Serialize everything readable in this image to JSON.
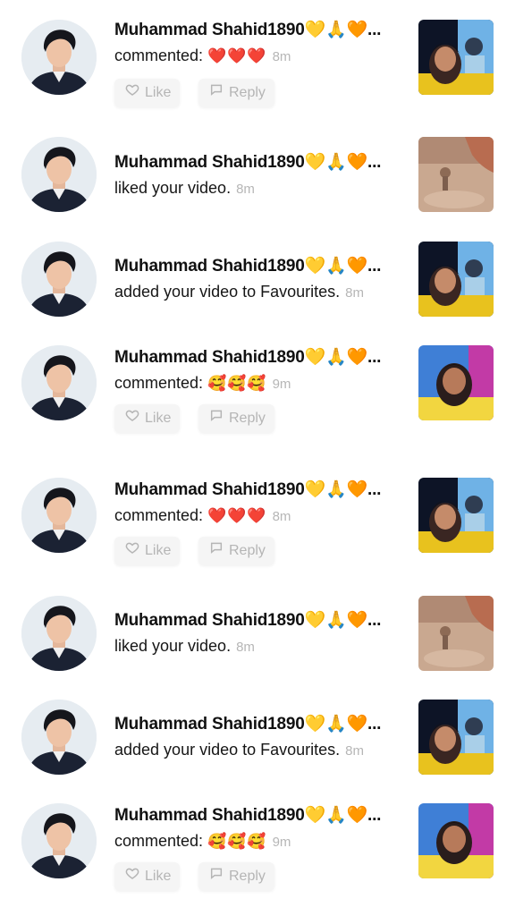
{
  "notifications": [
    {
      "user": "Muhammad Shahid1890💛🙏🧡...",
      "action": "commented:",
      "reaction": "❤️❤️❤️",
      "time": "8m",
      "has_buttons": true,
      "thumb": "portrait-sky"
    },
    {
      "user": "Muhammad Shahid1890💛🙏🧡...",
      "action": "liked your video.",
      "reaction": "",
      "time": "8m",
      "has_buttons": false,
      "thumb": "desert"
    },
    {
      "user": "Muhammad Shahid1890💛🙏🧡...",
      "action": "added your video to Favourites.",
      "reaction": "",
      "time": "8m",
      "has_buttons": false,
      "thumb": "portrait-sky"
    },
    {
      "user": "Muhammad Shahid1890💛🙏🧡...",
      "action": "commented:",
      "reaction": "🥰🥰🥰",
      "time": "9m",
      "has_buttons": true,
      "thumb": "portrait-neon"
    },
    {
      "user": "Muhammad Shahid1890💛🙏🧡...",
      "action": "commented:",
      "reaction": "❤️❤️❤️",
      "time": "8m",
      "has_buttons": true,
      "thumb": "portrait-sky"
    },
    {
      "user": "Muhammad Shahid1890💛🙏🧡...",
      "action": "liked your video.",
      "reaction": "",
      "time": "8m",
      "has_buttons": false,
      "thumb": "desert"
    },
    {
      "user": "Muhammad Shahid1890💛🙏🧡...",
      "action": "added your video to Favourites.",
      "reaction": "",
      "time": "8m",
      "has_buttons": false,
      "thumb": "portrait-sky"
    },
    {
      "user": "Muhammad Shahid1890💛🙏🧡...",
      "action": "commented:",
      "reaction": "🥰🥰🥰",
      "time": "9m",
      "has_buttons": true,
      "thumb": "portrait-neon"
    }
  ],
  "buttons": {
    "like_label": "Like",
    "reply_label": "Reply"
  },
  "icons": {
    "like": "heart-outline-icon",
    "reply": "comment-bubble-icon"
  },
  "colors": {
    "time": "#b6b6b6",
    "button_bg": "#f5f5f5",
    "button_text": "#b5b5b5"
  }
}
